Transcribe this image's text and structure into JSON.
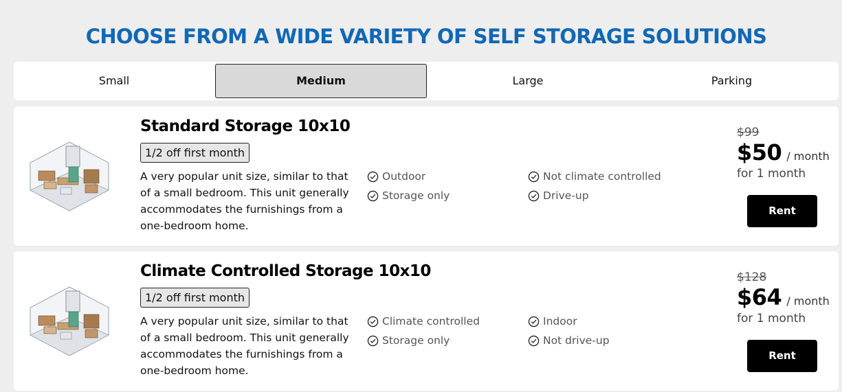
{
  "header": {
    "title": "CHOOSE FROM A WIDE VARIETY OF SELF STORAGE SOLUTIONS"
  },
  "tabs": [
    {
      "label": "Small"
    },
    {
      "label": "Medium",
      "active": true
    },
    {
      "label": "Large"
    },
    {
      "label": "Parking"
    }
  ],
  "units": [
    {
      "title": "Standard Storage 10x10",
      "promo": "1/2 off first month",
      "description": "A very popular unit size, similar to that of a small bedroom. This unit generally accommodates the furnishings from a one-bedroom home.",
      "features": [
        "Outdoor",
        "Not climate controlled",
        "Storage only",
        "Drive-up"
      ],
      "old_price": "$99",
      "price": "$50",
      "per": "/ month",
      "duration": "for 1 month",
      "button": "Rent"
    },
    {
      "title": "Climate Controlled Storage 10x10",
      "promo": "1/2 off first month",
      "description": "A very popular unit size, similar to that of a small bedroom. This unit generally accommodates the furnishings from a one-bedroom home.",
      "features": [
        "Climate controlled",
        "Indoor",
        "Storage only",
        "Not drive-up"
      ],
      "old_price": "$128",
      "price": "$64",
      "per": "/ month",
      "duration": "for 1 month",
      "button": "Rent"
    }
  ],
  "icons": {
    "unit_image": "storage-unit-illustration-icon",
    "feature": "check-circle-icon"
  },
  "colors": {
    "title": "#1168b5",
    "active_tab": "#d9d9d9",
    "rent_button": "#000000"
  }
}
